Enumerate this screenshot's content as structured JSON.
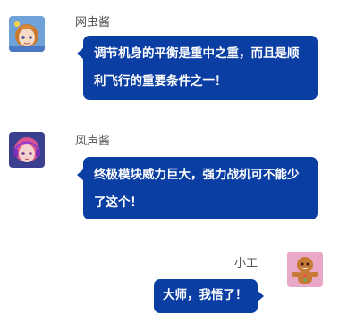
{
  "messages": [
    {
      "sender": "网虫酱",
      "avatar_icon": "anime-girl-orange-hair-icon",
      "text": "调节机身的平衡是重中之重，而且是顺利飞行的重要条件之一！"
    },
    {
      "sender": "风声酱",
      "avatar_icon": "anime-girl-pink-hair-headphones-icon",
      "text": "终极模块威力巨大，强力战机可不能少了这个！"
    },
    {
      "sender": "小工",
      "avatar_icon": "gingerbread-man-icon",
      "text": "大师，我悟了！"
    }
  ],
  "colors": {
    "bubble": "#0b3ea3",
    "bubble_text": "#ffffff",
    "name_text": "#555555"
  }
}
